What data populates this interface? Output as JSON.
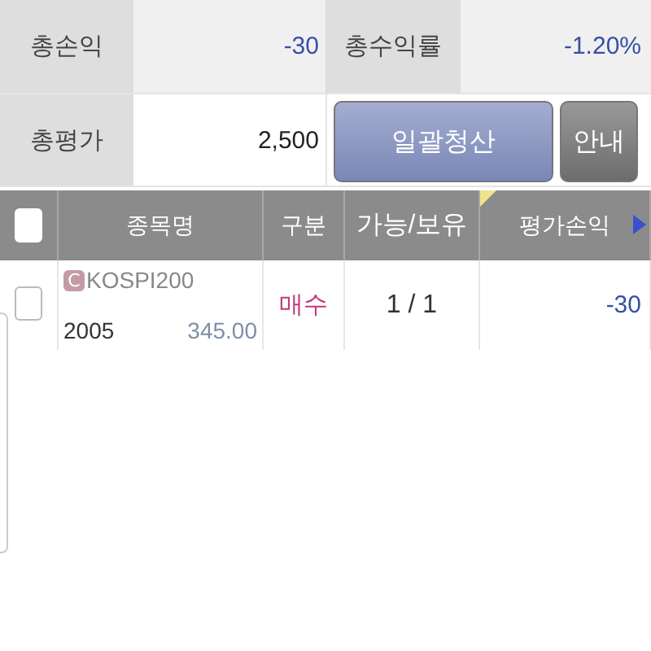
{
  "summary": {
    "total_pl": {
      "label": "총손익",
      "value": "-30"
    },
    "total_return": {
      "label": "총수익률",
      "value": "-1.20%"
    },
    "total_eval": {
      "label": "총평가",
      "value": "2,500"
    }
  },
  "buttons": {
    "liquidate": "일괄청산",
    "guide": "안내"
  },
  "table": {
    "select_all": {
      "checked": false
    },
    "columns": [
      "종목명",
      "구분",
      "가능/보유",
      "평가손익"
    ],
    "rows": [
      {
        "checked": false,
        "badge": "C",
        "name": "KOSPI200",
        "code": "2005",
        "price": "345.00",
        "side": "매수",
        "qty": "1 / 1",
        "pl": "-30"
      }
    ]
  }
}
